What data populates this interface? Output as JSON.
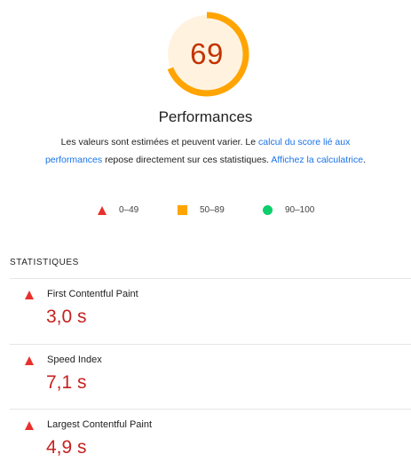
{
  "score": {
    "value": "69",
    "fraction": 0.69,
    "color": "#ffa400",
    "track_color": "#fff3e0"
  },
  "title": "Performances",
  "description": {
    "part1": "Les valeurs sont estimées et peuvent varier. Le ",
    "link1": "calcul du score lié aux performances",
    "part2": " repose directement sur ces statistiques. ",
    "link2": "Affichez la calculatrice",
    "part3": "."
  },
  "legend": [
    {
      "label": "0–49",
      "icon": "red-triangle-icon",
      "color": "#e8302c"
    },
    {
      "label": "50–89",
      "icon": "orange-square-icon",
      "color": "#ffa400"
    },
    {
      "label": "90–100",
      "icon": "green-circle-icon",
      "color": "#0cce6b"
    }
  ],
  "statistics": {
    "header": "STATISTIQUES",
    "metrics": [
      {
        "label": "First Contentful Paint",
        "value": "3,0 s",
        "status_icon": "red-triangle-icon"
      },
      {
        "label": "Speed Index",
        "value": "7,1 s",
        "status_icon": "red-triangle-icon"
      },
      {
        "label": "Largest Contentful Paint",
        "value": "4,9 s",
        "status_icon": "red-triangle-icon"
      }
    ]
  }
}
